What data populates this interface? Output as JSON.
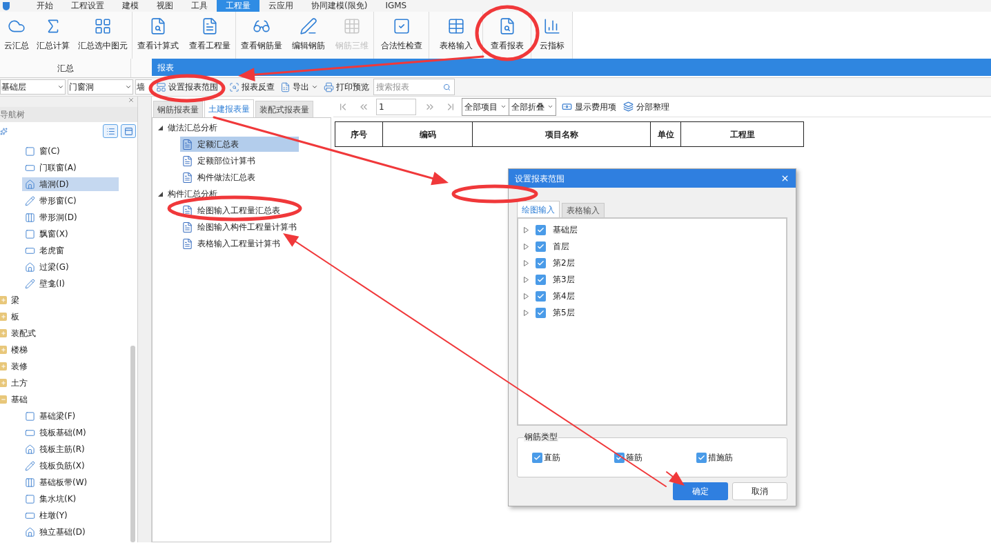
{
  "menu": [
    {
      "label": "开始",
      "selected": false
    },
    {
      "label": "工程设置",
      "selected": false
    },
    {
      "label": "建模",
      "selected": false
    },
    {
      "label": "视图",
      "selected": false
    },
    {
      "label": "工具",
      "selected": false
    },
    {
      "label": "工程量",
      "selected": true
    },
    {
      "label": "云应用",
      "selected": false
    },
    {
      "label": "协同建模(限免)",
      "selected": false
    },
    {
      "label": "IGMS",
      "selected": false
    }
  ],
  "ribbon": {
    "groups": [
      {
        "label": "汇总",
        "buttons": [
          {
            "label": "云汇总",
            "disabled": false
          },
          {
            "label": "汇总计算",
            "disabled": false
          },
          {
            "label": "汇总选中图元",
            "disabled": false
          }
        ]
      },
      {
        "buttons": [
          {
            "label": "查看计算式",
            "disabled": false
          },
          {
            "label": "查看工程量",
            "disabled": false
          }
        ]
      },
      {
        "buttons": [
          {
            "label": "查看钢筋量",
            "disabled": false
          },
          {
            "label": "编辑钢筋",
            "disabled": false
          },
          {
            "label": "钢筋三维",
            "disabled": true
          }
        ]
      },
      {
        "buttons": [
          {
            "label": "合法性检查",
            "disabled": false
          }
        ]
      },
      {
        "buttons": [
          {
            "label": "表格输入",
            "disabled": false
          }
        ]
      },
      {
        "buttons": [
          {
            "label": "查看报表",
            "disabled": false
          }
        ]
      },
      {
        "buttons": [
          {
            "label": "云指标",
            "disabled": false
          }
        ]
      }
    ]
  },
  "panel_title": "报表",
  "filters": [
    "基础层",
    "门窗洞",
    "墙"
  ],
  "report_toolbar": {
    "buttons": [
      {
        "label": "设置报表范围",
        "dropdown": false
      },
      {
        "label": "报表反查",
        "dropdown": false
      },
      {
        "label": "导出",
        "dropdown": true
      },
      {
        "label": "打印预览",
        "dropdown": false
      }
    ],
    "search": {
      "placeholder": "搜索报表"
    }
  },
  "nav_tree": {
    "title": "导航树",
    "items": [
      {
        "kind": "component",
        "label": "窗(C)",
        "selected": false
      },
      {
        "kind": "component",
        "label": "门联窗(A)",
        "selected": false
      },
      {
        "kind": "component",
        "label": "墙洞(D)",
        "selected": true
      },
      {
        "kind": "component",
        "label": "带形窗(C)",
        "selected": false
      },
      {
        "kind": "component",
        "label": "带形洞(D)",
        "selected": false
      },
      {
        "kind": "component",
        "label": "飘窗(X)",
        "selected": false
      },
      {
        "kind": "component",
        "label": "老虎窗",
        "selected": false
      },
      {
        "kind": "component",
        "label": "过梁(G)",
        "selected": false
      },
      {
        "kind": "component",
        "label": "壁龛(I)",
        "selected": false
      },
      {
        "kind": "folder",
        "label": "梁",
        "expanded": false
      },
      {
        "kind": "folder",
        "label": "板",
        "expanded": false
      },
      {
        "kind": "folder",
        "label": "装配式",
        "expanded": false
      },
      {
        "kind": "folder",
        "label": "楼梯",
        "expanded": false
      },
      {
        "kind": "folder",
        "label": "装修",
        "expanded": false
      },
      {
        "kind": "folder",
        "label": "土方",
        "expanded": false
      },
      {
        "kind": "folder",
        "label": "基础",
        "expanded": true,
        "children": [
          {
            "kind": "component",
            "label": "基础梁(F)",
            "selected": false
          },
          {
            "kind": "component",
            "label": "筏板基础(M)",
            "selected": false
          },
          {
            "kind": "component",
            "label": "筏板主筋(R)",
            "selected": false
          },
          {
            "kind": "component",
            "label": "筏板负筋(X)",
            "selected": false
          },
          {
            "kind": "component",
            "label": "基础板带(W)",
            "selected": false
          },
          {
            "kind": "component",
            "label": "集水坑(K)",
            "selected": false
          },
          {
            "kind": "component",
            "label": "柱墩(Y)",
            "selected": false
          },
          {
            "kind": "component",
            "label": "独立基础(D)",
            "selected": false
          }
        ]
      }
    ]
  },
  "report_tabs": [
    {
      "label": "钢筋报表量",
      "selected": false
    },
    {
      "label": "土建报表量",
      "selected": true
    },
    {
      "label": "装配式报表量",
      "selected": false
    }
  ],
  "report_tree": [
    {
      "label": "做法汇总分析",
      "expanded": true,
      "children": [
        {
          "label": "定额汇总表",
          "selected": true
        },
        {
          "label": "定额部位计算书",
          "selected": false
        },
        {
          "label": "构件做法汇总表",
          "selected": false
        }
      ]
    },
    {
      "label": "构件汇总分析",
      "expanded": true,
      "children": [
        {
          "label": "绘图输入工程量汇总表",
          "selected": false
        },
        {
          "label": "绘图输入构件工程量计算书",
          "selected": false
        },
        {
          "label": "表格输入工程量计算书",
          "selected": false
        }
      ]
    }
  ],
  "pager": {
    "page": "1",
    "scope": "全部项目",
    "fold": "全部折叠",
    "buttons": [
      "显示费用项",
      "分部整理"
    ]
  },
  "table": {
    "columns": [
      "序号",
      "编码",
      "项目名称",
      "单位",
      "工程里"
    ]
  },
  "dialog": {
    "title": "设置报表范围",
    "tabs": [
      {
        "label": "绘图输入",
        "selected": true
      },
      {
        "label": "表格输入",
        "selected": false
      }
    ],
    "floors": [
      {
        "label": "基础层",
        "checked": true,
        "expanded": false
      },
      {
        "label": "首层",
        "checked": true,
        "expanded": false
      },
      {
        "label": "第2层",
        "checked": true,
        "expanded": false
      },
      {
        "label": "第3层",
        "checked": true,
        "expanded": false
      },
      {
        "label": "第4层",
        "checked": true,
        "expanded": false
      },
      {
        "label": "第5层",
        "checked": true,
        "expanded": false
      }
    ],
    "rebar_group": {
      "title": "钢筋类型",
      "options": [
        {
          "label": "直筋",
          "checked": true
        },
        {
          "label": "箍筋",
          "checked": true
        },
        {
          "label": "措施筋",
          "checked": true
        }
      ]
    },
    "buttons": [
      {
        "label": "确定",
        "primary": true
      },
      {
        "label": "取消",
        "primary": false
      }
    ]
  }
}
